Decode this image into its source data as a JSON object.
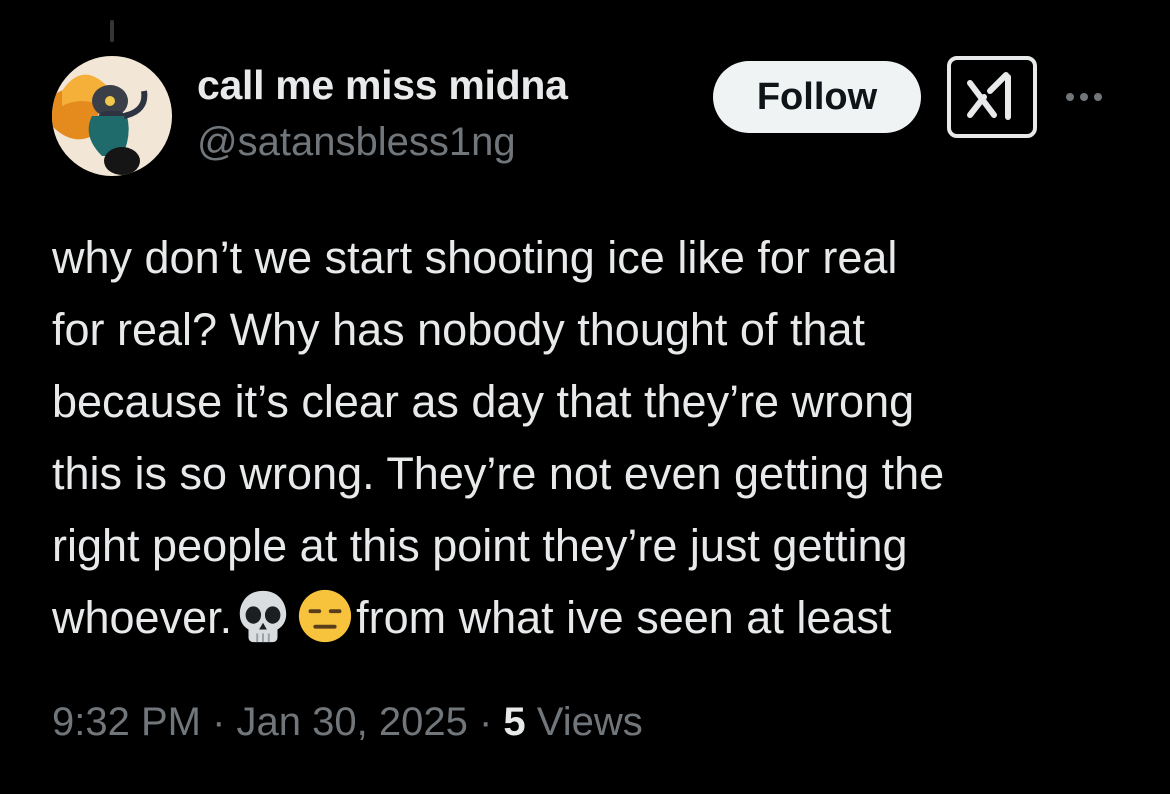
{
  "author": {
    "display_name": "call me miss midna",
    "handle": "@satansbless1ng",
    "avatar_icon": "avatar"
  },
  "actions": {
    "follow_label": "Follow",
    "grok_icon": "grok-icon",
    "more_icon": "more-icon"
  },
  "tweet": {
    "lines": [
      "why don’t we start shooting ice like for real",
      "for real? Why has nobody thought of that",
      "because it’s clear as day that they’re wrong",
      "this is so wrong. They’re not even getting the",
      "right people at this point they’re just getting"
    ],
    "last_line_before": "whoever.",
    "emojis": [
      "skull-emoji",
      "expressionless-face-emoji"
    ],
    "last_line_after": "from what ive seen at least"
  },
  "meta": {
    "time": "9:32 PM",
    "separator": " · ",
    "date": "Jan 30, 2025",
    "views_count": "5",
    "views_label": "Views"
  },
  "colors": {
    "background": "#000000",
    "text": "#e7e9ea",
    "secondary_text": "#71767b",
    "follow_bg": "#eff3f4"
  }
}
